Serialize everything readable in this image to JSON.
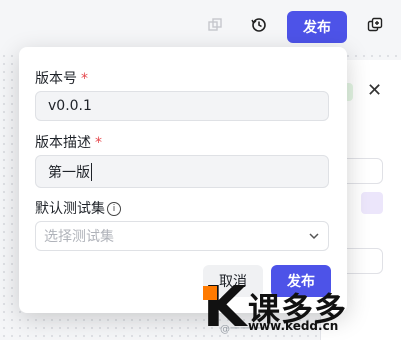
{
  "topbar": {
    "publish_label": "发布",
    "icons": [
      "duplicate-icon",
      "history-icon",
      "copy-icon"
    ]
  },
  "dialog": {
    "version_label": "版本号",
    "required_mark": "*",
    "version_value": "v0.0.1",
    "desc_label": "版本描述",
    "desc_value": "第一版",
    "testset_label": "默认测试集",
    "testset_placeholder": "选择测试集",
    "cancel_label": "取消",
    "publish_label": "发布"
  },
  "watermark": {
    "brand": "课多多",
    "url": "www.kedd.cn",
    "faint": "@一一一一"
  },
  "colors": {
    "primary": "#4d53e8",
    "required": "#e5484d",
    "watermark_accent": "#ff7a00"
  }
}
